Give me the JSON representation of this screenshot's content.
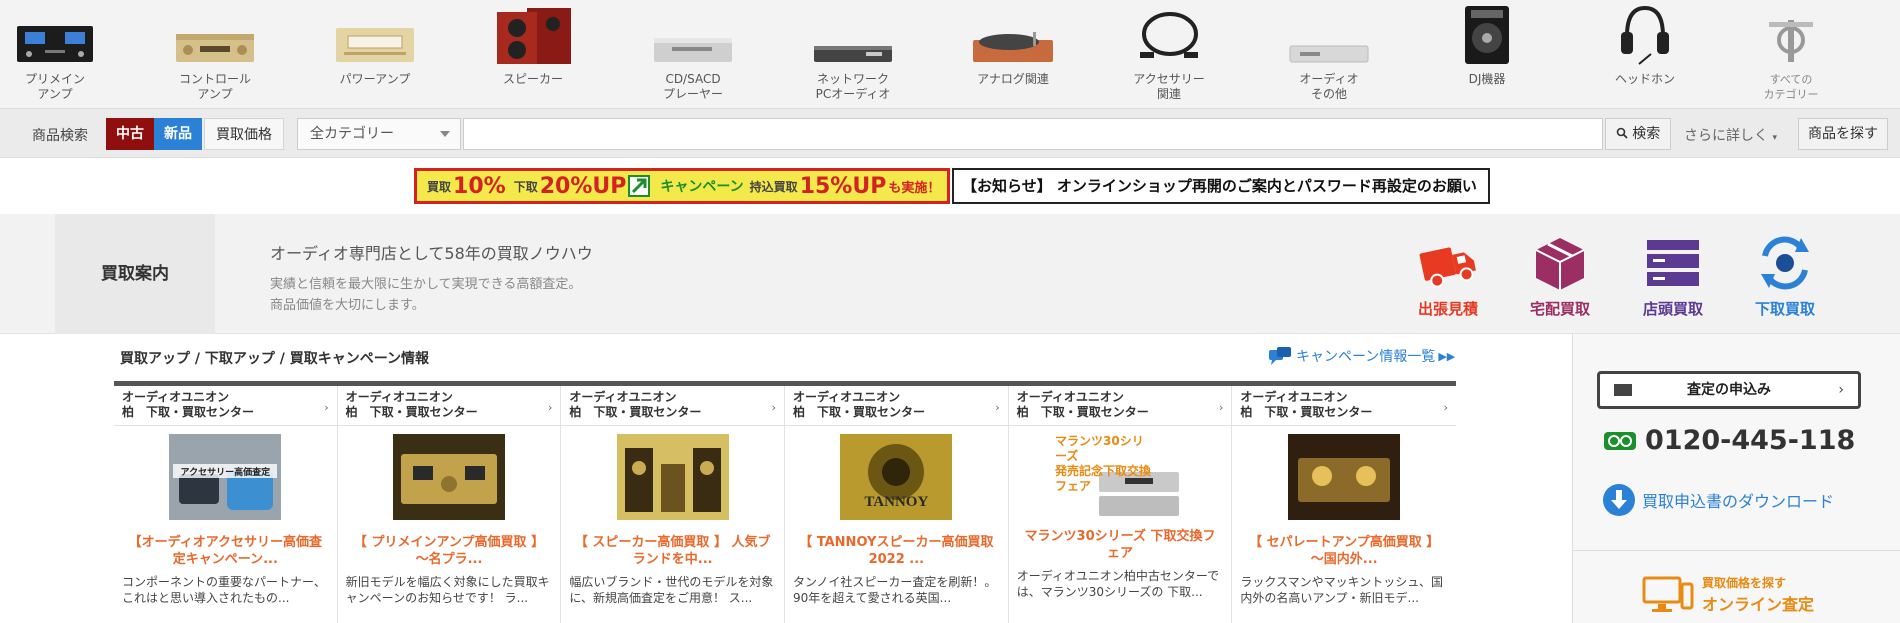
{
  "categories": [
    {
      "label": "プリメイン\nアンプ",
      "icon": "integrated-amp-icon"
    },
    {
      "label": "コントロール\nアンプ",
      "icon": "control-amp-icon"
    },
    {
      "label": "パワーアンプ",
      "icon": "power-amp-icon"
    },
    {
      "label": "スピーカー",
      "icon": "speaker-icon"
    },
    {
      "label": "CD/SACD\nプレーヤー",
      "icon": "cd-player-icon"
    },
    {
      "label": "ネットワーク\nPCオーディオ",
      "icon": "network-audio-icon"
    },
    {
      "label": "アナログ関連",
      "icon": "turntable-icon"
    },
    {
      "label": "アクセサリー\n関連",
      "icon": "cable-icon"
    },
    {
      "label": "オーディオ\nその他",
      "icon": "audio-other-icon"
    },
    {
      "label": "DJ機器",
      "icon": "dj-icon"
    },
    {
      "label": "ヘッドホン",
      "icon": "headphone-icon"
    },
    {
      "label": "すべての\nカテゴリー",
      "icon": "all-categories-icon"
    }
  ],
  "search": {
    "label": "商品検索",
    "used": "中古",
    "new": "新品",
    "buy_price": "買取価格",
    "category": "全カテゴリー",
    "placeholder": "",
    "search_button": "検索",
    "more": "さらに詳しく",
    "find": "商品を探す"
  },
  "banner1": {
    "p1": "買取",
    "v1": "10%",
    "p2": "下取",
    "v2": "20%UP",
    "campaign": "キャンペーン",
    "p3": "持込買取",
    "v3": "15%UP",
    "tail": "も実施！"
  },
  "banner2": "【お知らせ】 オンラインショップ再開のご案内とパスワード再設定のお願い",
  "guide": {
    "tab": "買取案内",
    "lead": "オーディオ専門店として58年の買取ノウハウ",
    "desc1": "実績と信頼を最大限に生かして実現できる高額査定。",
    "desc2": "商品価値を大切にします。",
    "items": [
      {
        "label": "出張見積",
        "icon": "truck-icon",
        "color": "#e83a22"
      },
      {
        "label": "宅配買取",
        "icon": "box-icon",
        "color": "#9b2f63"
      },
      {
        "label": "店頭買取",
        "icon": "store-icon",
        "color": "#5b3a93"
      },
      {
        "label": "下取買取",
        "icon": "exchange-icon",
        "color": "#2b81d6"
      }
    ]
  },
  "main": {
    "heading": "買取アップ / 下取アップ / 買取キャンペーン情報",
    "more_link": "キャンペーン情報一覧"
  },
  "cards": [
    {
      "store1": "オーディオユニオン",
      "store2": "柏　下取・買取センター",
      "title": "【オーディオアクセサリー高価査定キャンペーン...",
      "desc": "コンポーネントの重要なパートナー、これはと思い導入されたもの..."
    },
    {
      "store1": "オーディオユニオン",
      "store2": "柏　下取・買取センター",
      "title": "【 プリメインアンプ高価買取 】 ～名プラ...",
      "desc": "新旧モデルを幅広く対象にした買取キャンペーンのお知らせです！ ラ..."
    },
    {
      "store1": "オーディオユニオン",
      "store2": "柏　下取・買取センター",
      "title": "【 スピーカー高価買取 】 人気ブランドを中...",
      "desc": "幅広いブランド・世代のモデルを対象に、新規高価査定をご用意！ ス..."
    },
    {
      "store1": "オーディオユニオン",
      "store2": "柏　下取・買取センター",
      "title": "【 TANNOYスピーカー高価買取 2022 ...",
      "desc": "タンノイ社スピーカー査定を刷新！。 90年を超えて愛される英国..."
    },
    {
      "store1": "オーディオユニオン",
      "store2": "柏　下取・買取センター",
      "title": "マランツ30シリーズ 下取交換フェア",
      "desc": "オーディオユニオン柏中古センターでは、マランツ30シリーズの 下取..."
    },
    {
      "store1": "オーディオユニオン",
      "store2": "柏　下取・買取センター",
      "title": "【 セパレートアンプ高価買取 】 ～国内外...",
      "desc": "ラックスマンやマッキントッシュ、国内外の名高いアンプ・新旧モデ..."
    }
  ],
  "card_image_text": {
    "accessory": "アクセサリー高価査定",
    "tannoy": "TANNOY",
    "marantz1": "マランツ30シリーズ",
    "marantz2": "発売記念下取交換",
    "marantz3": "フェア"
  },
  "side": {
    "apply": "査定の申込み",
    "phone": "0120-445-118",
    "download": "買取申込書のダウンロード",
    "online1": "買取価格を探す",
    "online2": "オンライン査定"
  },
  "colors": {
    "used": "#8f0e0e",
    "new": "#2b81d6",
    "link": "#2b81d6",
    "card_title": "#e9692c",
    "online": "#e98a12"
  }
}
